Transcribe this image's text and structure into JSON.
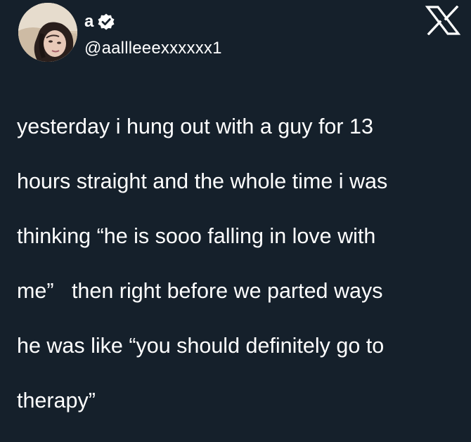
{
  "tweet": {
    "display_name": "a",
    "handle": "@aallleeexxxxxx1",
    "verified": true,
    "text_lines": [
      "yesterday i hung out with a guy for 13",
      "hours straight and the whole time i was",
      "thinking “he is sooo falling in love with",
      "me”   then right before we parted ways",
      "he was like “you should definitely go to",
      "therapy”"
    ]
  },
  "icons": {
    "avatar": "profile-photo",
    "verified": "verified-badge-icon",
    "logo": "x-logo-icon"
  },
  "colors": {
    "background": "#15202b",
    "text": "#ffffff"
  }
}
